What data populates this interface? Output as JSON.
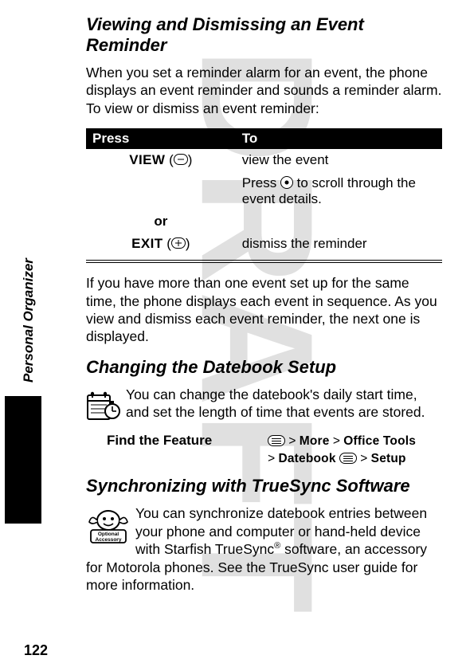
{
  "watermark": "DRAFT",
  "sideLabel": "Personal Organizer",
  "section1": {
    "title": "Viewing and Dismissing an Event Reminder",
    "intro": "When you set a reminder alarm for an event, the phone displays an event reminder and sounds a reminder alarm. To view or dismiss an event reminder:",
    "table": {
      "headPress": "Press",
      "headTo": "To",
      "rows": [
        {
          "keyLabel": "VIEW",
          "keyParen": "(",
          "keyClose": ")",
          "to": "view the event"
        },
        {
          "to": "Press ",
          "toAfter": " to scroll through the event details."
        },
        {
          "or": "or"
        },
        {
          "keyLabel": "EXIT",
          "keyParen": "(",
          "keyClose": ")",
          "to": "dismiss the reminder"
        }
      ]
    },
    "after": "If you have more than one event set up for the same time, the phone displays each event in sequence. As you view and dismiss each event reminder, the next one is displayed."
  },
  "section2": {
    "title": "Changing the Datebook Setup",
    "body": "You can change the datebook's daily start time, and set the length of time that events are stored.",
    "findFeatureLabel": "Find the Feature",
    "path": {
      "p1": "More",
      "p2": "Office Tools",
      "p3": "Datebook",
      "p4": "Setup"
    }
  },
  "section3": {
    "title": "Synchronizing with TrueSync Software",
    "body1": "You can synchronize datebook entries between your phone and computer or hand-held device with Starfish TrueSync",
    "body2": " software, an accessory for Motorola phones. See the TrueSync user guide for more information.",
    "accessoryLabel1": "Optional",
    "accessoryLabel2": "Accessory"
  },
  "pageNumber": "122"
}
